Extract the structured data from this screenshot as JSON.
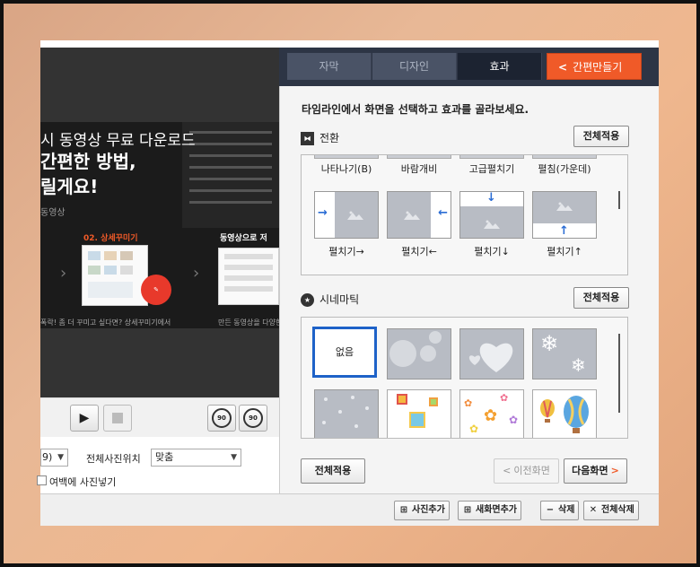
{
  "video": {
    "title_line1": "시 동영상 무료 다운로드",
    "title_line2": "간편한 방법,",
    "title_line3": "릴게요!",
    "small_text": "동영상",
    "step2_label": "02. 상세꾸미기",
    "step_next_label": "동영상으로 저",
    "caption_left": "폭락!   좀 더 꾸미고 싶다면? 상세꾸미기에서",
    "caption_right": "만든 동영상을 다양한 곳"
  },
  "player": {
    "play_icon": "▶",
    "rotate_left_label": "90",
    "rotate_right_label": "90"
  },
  "settings": {
    "small_select_value": "9)",
    "photo_position_label": "전체사진위치",
    "photo_position_value": "맞춤",
    "margin_checkbox_label": "여백에 사진넣기",
    "margin_checked": false
  },
  "tabs": [
    {
      "label": "자막",
      "active": false
    },
    {
      "label": "디자인",
      "active": false
    },
    {
      "label": "효과",
      "active": true
    }
  ],
  "simple_make": {
    "label": "간편만들기",
    "chevron": "<"
  },
  "instruction": "타임라인에서 화면을 선택하고 효과를 골라보세요.",
  "transition": {
    "title": "전환",
    "apply_label": "전체적용",
    "top_row": [
      "나타나기(B)",
      "바람개비",
      "고급펼치기",
      "펼침(가운데)"
    ],
    "items": [
      {
        "label": "펼치기→",
        "arrow": "→"
      },
      {
        "label": "펼치기←",
        "arrow": "←"
      },
      {
        "label": "펼치기↓",
        "arrow": "↓"
      },
      {
        "label": "펼치기↑",
        "arrow": "↑"
      }
    ]
  },
  "cinematic": {
    "title": "시네마틱",
    "apply_label": "전체적용",
    "none_label": "없음",
    "items": [
      "bubbles",
      "hearts",
      "snowflakes",
      "dots",
      "gifts",
      "flowers",
      "balloons"
    ]
  },
  "actions": {
    "apply_all": "전체적용",
    "prev": "이전화면",
    "next": "다음화면",
    "prev_chevron": "<",
    "next_chevron": ">"
  },
  "footer": {
    "add_photo": "사진추가",
    "add_new_screen": "새화면추가",
    "delete": "삭제",
    "delete_all": "전체삭제"
  },
  "colors": {
    "accent": "#f05a28",
    "tab_bar": "#2d3545",
    "selected_border": "#1e62c8",
    "transition_arrow": "#2a6cd4"
  }
}
